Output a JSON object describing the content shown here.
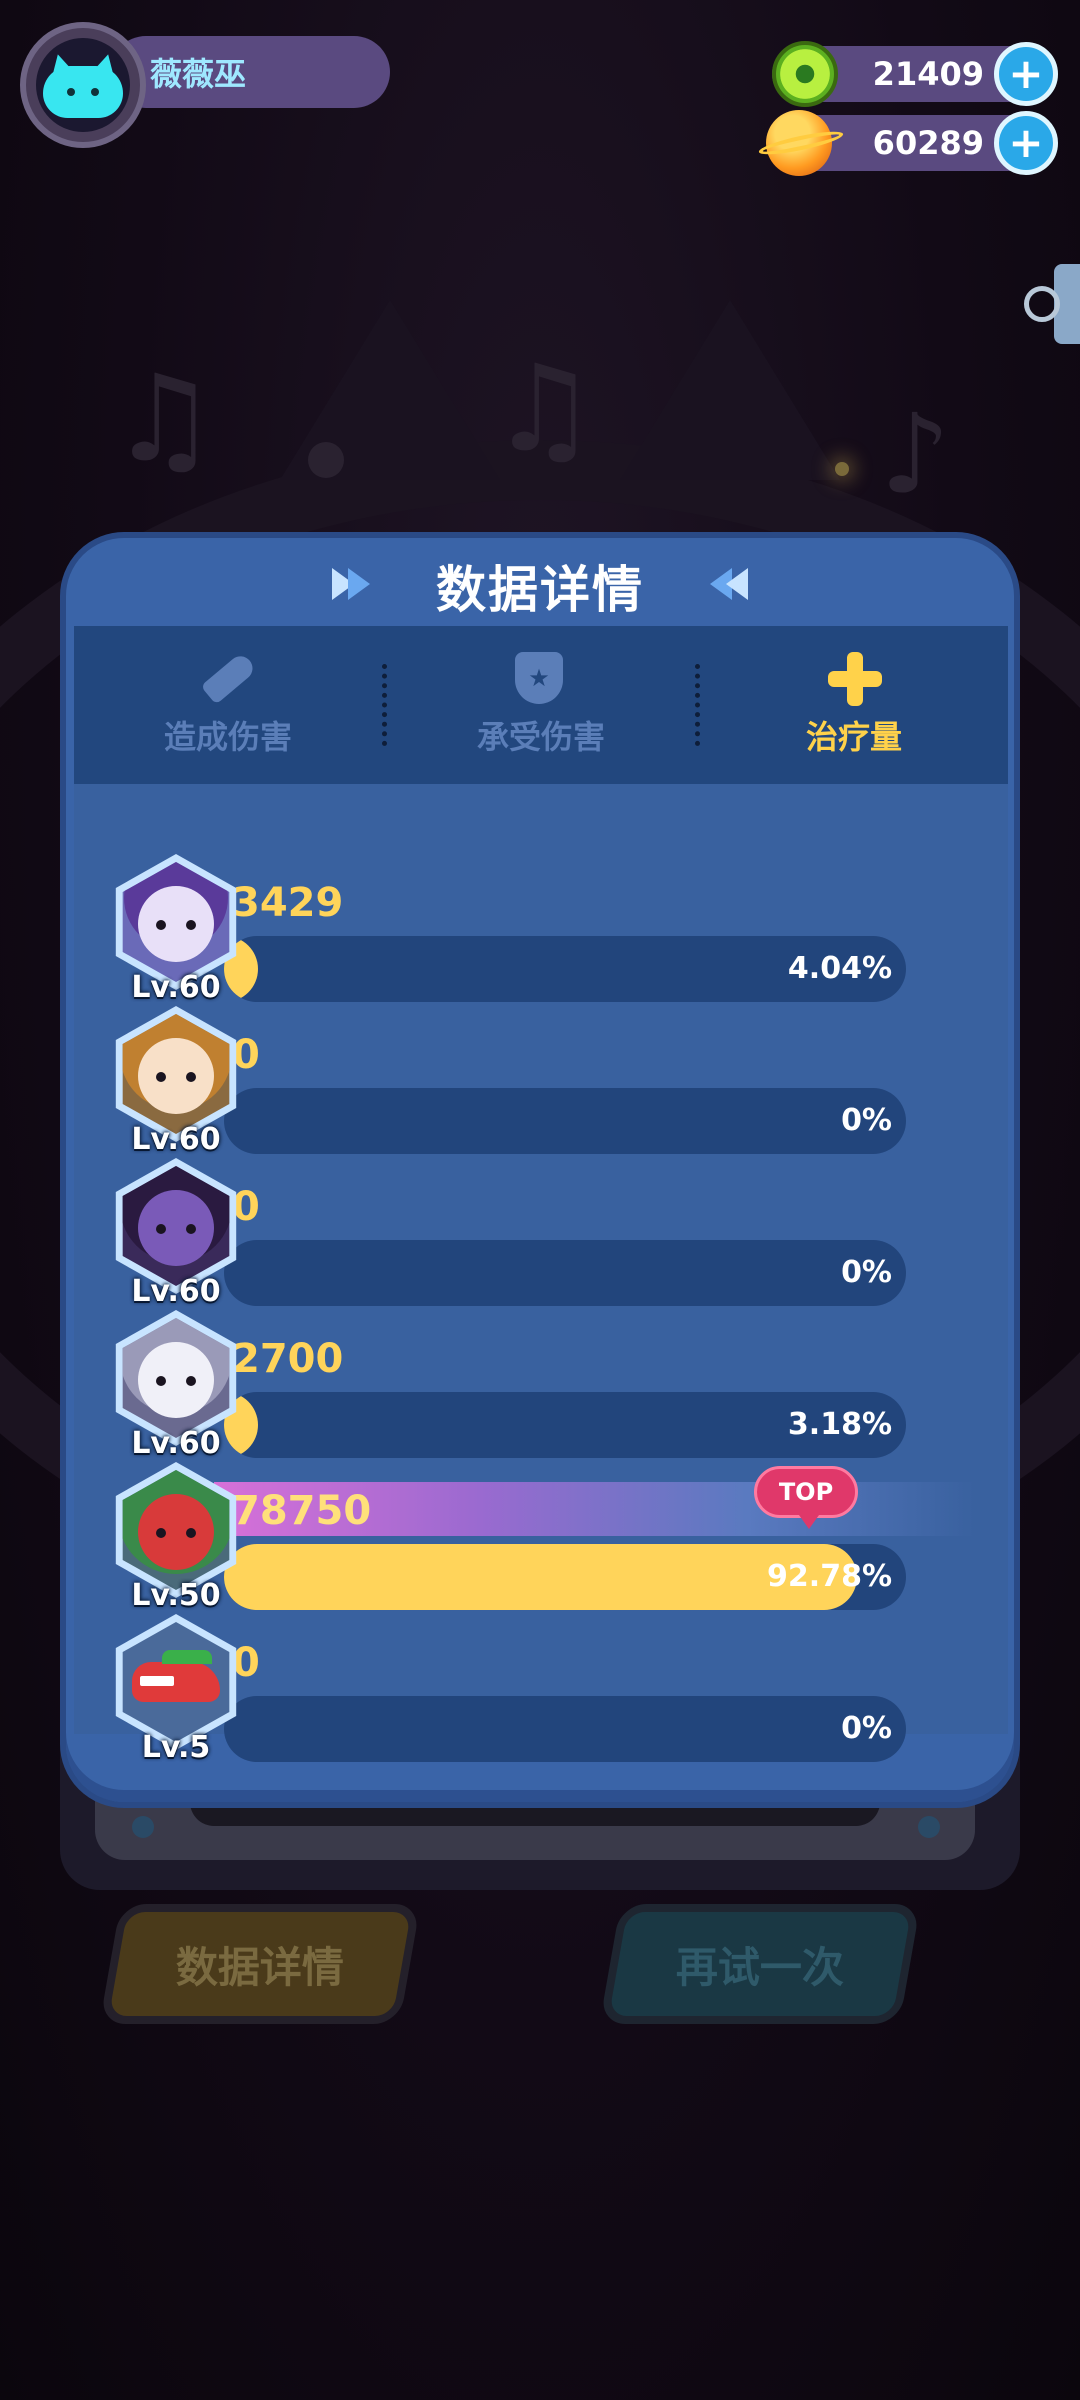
{
  "player": {
    "name": "薇薇巫",
    "avatar_icon": "cat-face-icon"
  },
  "currency": [
    {
      "icon": "green-donut-coin-icon",
      "value": "21409",
      "add_label": "+"
    },
    {
      "icon": "orange-planet-coin-icon",
      "value": "60289",
      "add_label": "+"
    }
  ],
  "panel": {
    "title": "数据详情",
    "tabs": [
      {
        "label": "造成伤害",
        "icon": "sword-icon",
        "active": false
      },
      {
        "label": "承受伤害",
        "icon": "shield-icon",
        "active": false
      },
      {
        "label": "治疗量",
        "icon": "plus-icon",
        "active": true
      }
    ],
    "top_badge": "TOP"
  },
  "rows": [
    {
      "level": "Lv.60",
      "value": "3429",
      "percent": "4.04%",
      "fraction": 0.0404
    },
    {
      "level": "Lv.60",
      "value": "0",
      "percent": "0%",
      "fraction": 0
    },
    {
      "level": "Lv.60",
      "value": "0",
      "percent": "0%",
      "fraction": 0
    },
    {
      "level": "Lv.60",
      "value": "2700",
      "percent": "3.18%",
      "fraction": 0.0318
    },
    {
      "level": "Lv.50",
      "value": "78750",
      "percent": "92.78%",
      "fraction": 0.9278,
      "top": true
    },
    {
      "level": "Lv.5",
      "value": "0",
      "percent": "0%",
      "fraction": 0
    }
  ],
  "bottom_buttons": {
    "data_details": "数据详情",
    "retry": "再试一次"
  },
  "colors": {
    "panel_blue": "#3a64a8",
    "bar_fill": "#ffd45a",
    "active_tab": "#ffd24a",
    "top_badge": "#e0386a"
  }
}
